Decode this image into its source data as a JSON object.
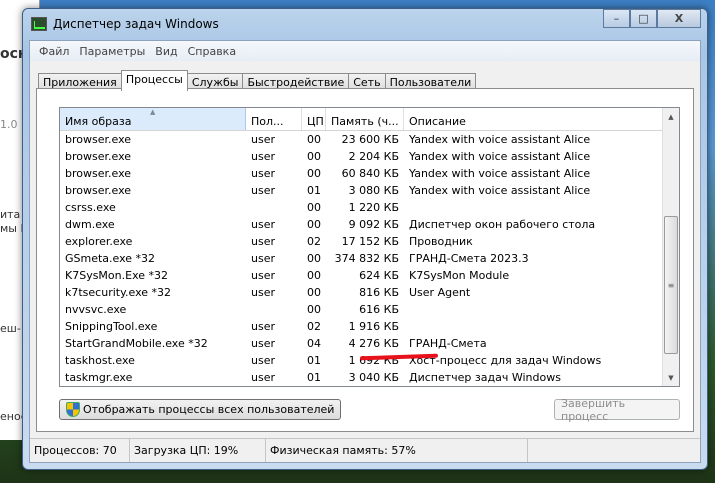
{
  "background": {
    "fragments": [
      "осн",
      "1.0",
      "ита",
      "мы П",
      "еш-",
      "енос"
    ]
  },
  "window": {
    "title": "Диспетчер задач Windows",
    "controls": {
      "minimize": "–",
      "maximize": "□",
      "close": "X"
    }
  },
  "menu": [
    "Файл",
    "Параметры",
    "Вид",
    "Справка"
  ],
  "tabs": [
    "Приложения",
    "Процессы",
    "Службы",
    "Быстродействие",
    "Сеть",
    "Пользователи"
  ],
  "active_tab": "Процессы",
  "columns": [
    "Имя образа",
    "Пол...",
    "ЦП",
    "Память (ч...",
    "Описание"
  ],
  "rows": [
    {
      "name": "browser.exe",
      "user": "user",
      "cpu": "00",
      "mem": "23 600 КБ",
      "desc": "Yandex with voice assistant Alice"
    },
    {
      "name": "browser.exe",
      "user": "user",
      "cpu": "00",
      "mem": "2 204 КБ",
      "desc": "Yandex with voice assistant Alice"
    },
    {
      "name": "browser.exe",
      "user": "user",
      "cpu": "00",
      "mem": "60 840 КБ",
      "desc": "Yandex with voice assistant Alice"
    },
    {
      "name": "browser.exe",
      "user": "user",
      "cpu": "01",
      "mem": "3 080 КБ",
      "desc": "Yandex with voice assistant Alice"
    },
    {
      "name": "csrss.exe",
      "user": "",
      "cpu": "00",
      "mem": "1 220 КБ",
      "desc": ""
    },
    {
      "name": "dwm.exe",
      "user": "user",
      "cpu": "00",
      "mem": "9 092 КБ",
      "desc": "Диспетчер окон рабочего стола"
    },
    {
      "name": "explorer.exe",
      "user": "user",
      "cpu": "02",
      "mem": "17 152 КБ",
      "desc": "Проводник"
    },
    {
      "name": "GSmeta.exe *32",
      "user": "user",
      "cpu": "00",
      "mem": "374 832 КБ",
      "desc": "ГРАНД-Смета 2023.3"
    },
    {
      "name": "K7SysMon.Exe *32",
      "user": "user",
      "cpu": "00",
      "mem": "624 КБ",
      "desc": "K7SysMon Module"
    },
    {
      "name": "k7tsecurity.exe *32",
      "user": "user",
      "cpu": "00",
      "mem": "816 КБ",
      "desc": "User Agent"
    },
    {
      "name": "nvvsvc.exe",
      "user": "",
      "cpu": "00",
      "mem": "616 КБ",
      "desc": ""
    },
    {
      "name": "SnippingTool.exe",
      "user": "user",
      "cpu": "02",
      "mem": "1 916 КБ",
      "desc": ""
    },
    {
      "name": "StartGrandMobile.exe *32",
      "user": "user",
      "cpu": "04",
      "mem": "4 276 КБ",
      "desc": "ГРАНД-Смета"
    },
    {
      "name": "taskhost.exe",
      "user": "user",
      "cpu": "01",
      "mem": "1 692 КБ",
      "desc": "Хост-процесс для задач Windows"
    },
    {
      "name": "taskmgr.exe",
      "user": "user",
      "cpu": "01",
      "mem": "3 040 КБ",
      "desc": "Диспетчер задач Windows"
    }
  ],
  "buttons": {
    "show_all": "Отображать процессы всех пользователей",
    "end_process": "Завершить процесс"
  },
  "status": {
    "processes": "Процессов: 70",
    "cpu": "Загрузка ЦП: 19%",
    "memory": "Физическая память: 57%"
  },
  "colors": {
    "annotation": "#e8101a",
    "header_selected": "#dcebfc"
  }
}
